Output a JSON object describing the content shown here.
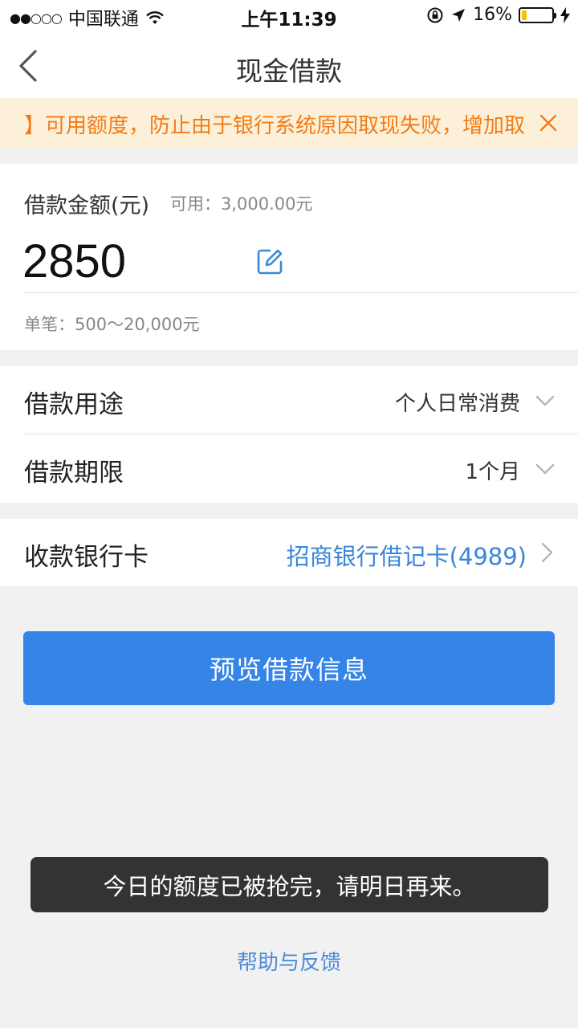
{
  "status_bar": {
    "signal": "●●○○○",
    "carrier": "中国联通",
    "time": "上午11:39",
    "battery_percent": "16%",
    "battery_level": 0.16,
    "icons": [
      "wifi-icon",
      "orientation-lock-icon",
      "location-arrow-icon",
      "battery-icon",
      "charging-bolt-icon"
    ]
  },
  "nav": {
    "title": "现金借款",
    "back_icon": "chevron-left-icon"
  },
  "notice": {
    "text": "】可用额度，防止由于银行系统原因取现失败，增加取",
    "color": "#f27c18",
    "close_icon": "close-icon"
  },
  "amount": {
    "label": "借款金额(元)",
    "available": "可用：3,000.00元",
    "value": "2850",
    "edit_icon": "edit-icon",
    "range": "单笔：500～20,000元"
  },
  "options": [
    {
      "label": "借款用途",
      "value": "个人日常消费",
      "icon": "chevron-down-icon"
    },
    {
      "label": "借款期限",
      "value": "1个月",
      "icon": "chevron-down-icon"
    }
  ],
  "bank": {
    "label": "收款银行卡",
    "value": "招商银行借记卡(4989)",
    "icon": "chevron-right-icon"
  },
  "primary_button": {
    "label": "预览借款信息",
    "color": "#3584e8"
  },
  "toast": {
    "text": "今日的额度已被抢完，请明日再来。"
  },
  "help": {
    "label": "帮助与反馈"
  }
}
